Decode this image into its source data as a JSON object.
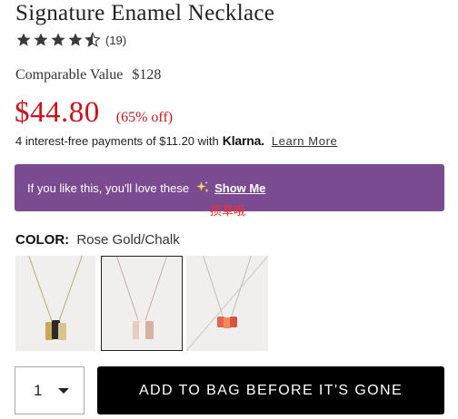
{
  "product": {
    "title": "Signature Enamel Necklace",
    "rating": {
      "stars": 4.5,
      "max_stars": 5,
      "count_label": "(19)"
    },
    "comparable_label": "Comparable Value",
    "comparable_value": "$128",
    "price": "$44.80",
    "discount": "(65% off)"
  },
  "klarna": {
    "text": "4 interest-free payments of $11.20 with",
    "logo_text": "Klarna.",
    "link": "Learn More"
  },
  "banner": {
    "text": "If you like this, you'll love these",
    "icon": "sparkle-icon",
    "link": "Show Me",
    "bg_color": "#7b4b92"
  },
  "overlay_text": "损草哦",
  "color_selector": {
    "label": "COLOR:",
    "value": "Rose Gold/Chalk",
    "swatches": [
      {
        "name": "gold-black",
        "selected": false,
        "unavailable": false
      },
      {
        "name": "rose-gold-chalk",
        "selected": true,
        "unavailable": false
      },
      {
        "name": "silver-coral",
        "selected": false,
        "unavailable": true
      }
    ]
  },
  "purchase": {
    "quantity": "1",
    "add_button": "ADD TO BAG BEFORE IT'S GONE"
  },
  "colors": {
    "price_red": "#c4161c",
    "button_bg": "#000000",
    "banner_purple": "#7b4b92"
  }
}
